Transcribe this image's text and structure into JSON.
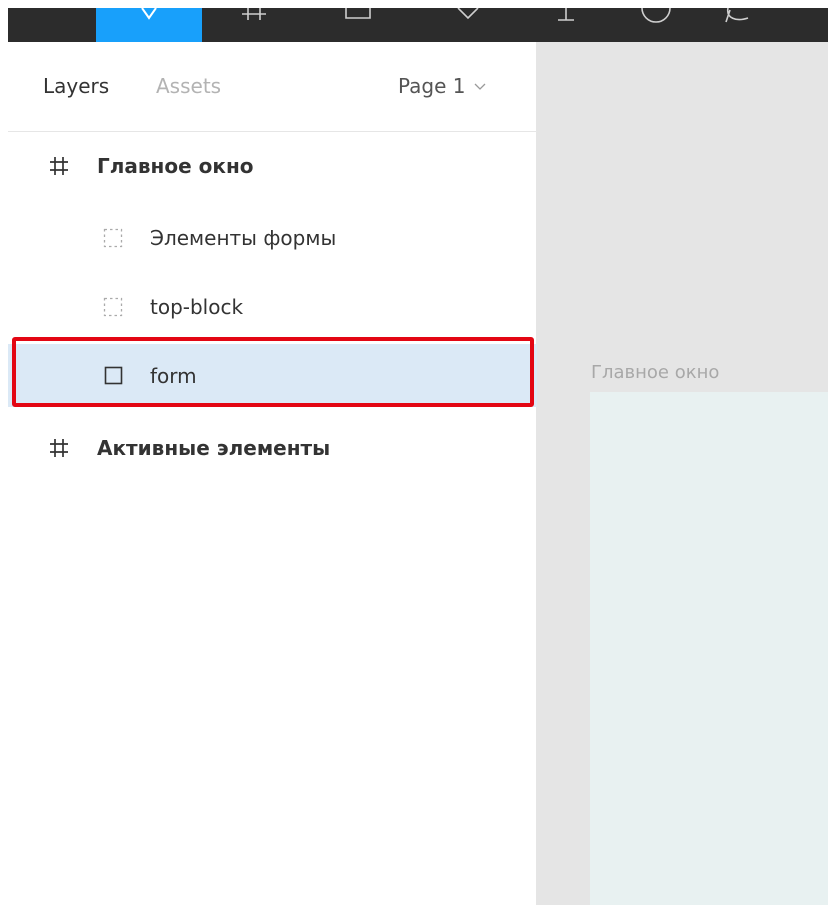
{
  "panel": {
    "tabs": {
      "layers": "Layers",
      "assets": "Assets"
    },
    "page_selector": "Page 1"
  },
  "layers": [
    {
      "name": "Главное окно",
      "type": "frame",
      "level": 0,
      "selected": false
    },
    {
      "name": "Элементы формы",
      "type": "group",
      "level": 1,
      "selected": false
    },
    {
      "name": "top-block",
      "type": "group",
      "level": 1,
      "selected": false
    },
    {
      "name": "form",
      "type": "rectangle",
      "level": 1,
      "selected": true
    },
    {
      "name": "Активные элементы",
      "type": "frame",
      "level": 0,
      "selected": false
    }
  ],
  "canvas": {
    "frame_label": "Главное окно"
  },
  "colors": {
    "toolbar_bg": "#2c2c2c",
    "tool_active": "#18a0fb",
    "selected_row": "#dbe9f6",
    "highlight_border": "#e30613",
    "canvas_bg": "#e5e5e5",
    "frame_fill": "#e8f1f1"
  }
}
